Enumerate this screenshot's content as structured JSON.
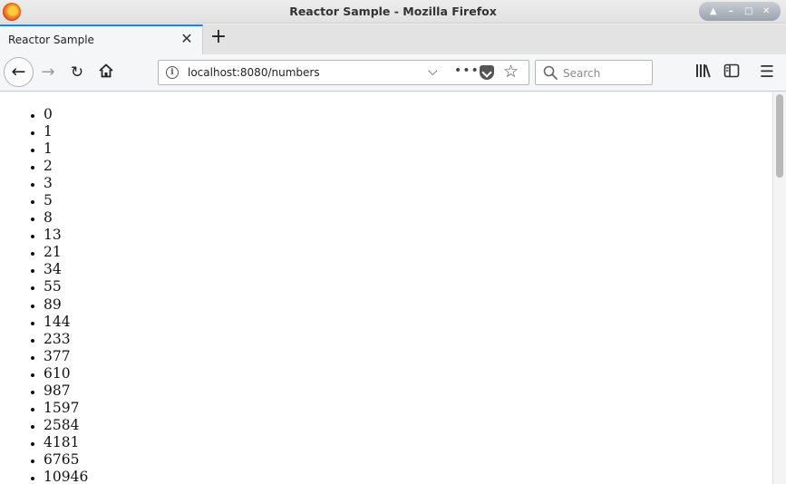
{
  "window": {
    "title": "Reactor Sample - Mozilla Firefox"
  },
  "tabs": [
    {
      "label": "Reactor Sample",
      "active": true
    }
  ],
  "toolbar": {
    "url": "localhost:8080/numbers",
    "search_placeholder": "Search",
    "new_tab_glyph": "+",
    "back_icon": "back-arrow-icon",
    "forward_icon": "forward-arrow-icon",
    "reload_icon": "reload-icon",
    "home_icon": "home-icon",
    "page_actions": [
      "chevron-down-icon",
      "more-dots-icon",
      "pocket-icon",
      "bookmark-star-icon"
    ],
    "right_icons": [
      "library-icon",
      "sidebar-icon",
      "hamburger-menu-icon"
    ]
  },
  "colors": {
    "active_tab_accent": "#0a84ff",
    "content_background": "#ffffff"
  },
  "page": {
    "numbers": [
      "0",
      "1",
      "1",
      "2",
      "3",
      "5",
      "8",
      "13",
      "21",
      "34",
      "55",
      "89",
      "144",
      "233",
      "377",
      "610",
      "987",
      "1597",
      "2584",
      "4181",
      "6765",
      "10946"
    ]
  }
}
